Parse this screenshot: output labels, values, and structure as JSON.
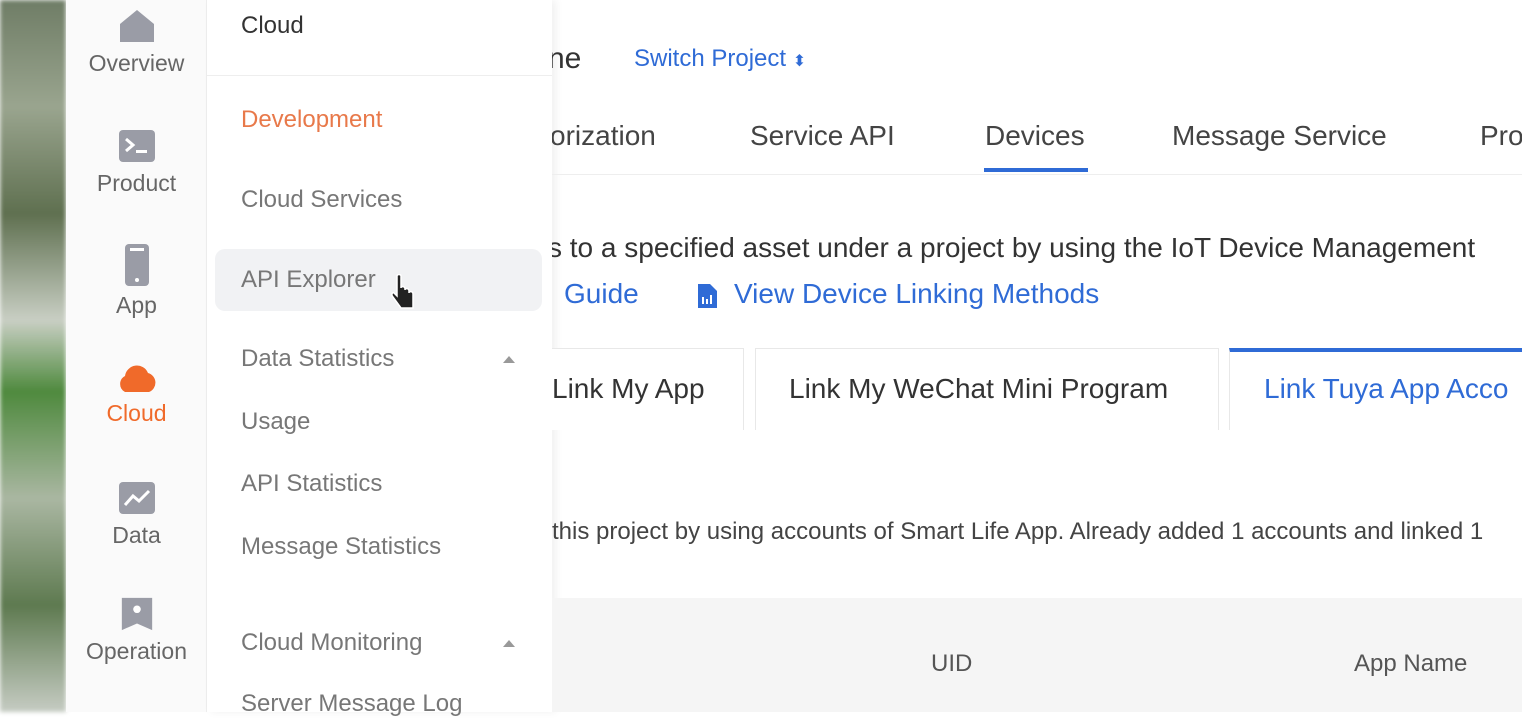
{
  "rail": {
    "items": [
      {
        "label": "Overview",
        "icon": "home-icon"
      },
      {
        "label": "Product",
        "icon": "terminal-icon"
      },
      {
        "label": "App",
        "icon": "phone-icon"
      },
      {
        "label": "Cloud",
        "icon": "cloud-icon",
        "active": true
      },
      {
        "label": "Data",
        "icon": "chart-icon"
      },
      {
        "label": "Operation",
        "icon": "bookmark-star-icon"
      }
    ]
  },
  "submenu": {
    "title": "Cloud",
    "items": [
      "Development",
      "Cloud Services",
      "API Explorer",
      "Data Statistics",
      "Usage",
      "API Statistics",
      "Message Statistics",
      "Cloud Monitoring",
      "Server Message Log"
    ]
  },
  "header": {
    "title_fragment": "ne",
    "switch_project": "Switch Project"
  },
  "tabs": [
    "orization",
    "Service API",
    "Devices",
    "Message Service",
    "Pro"
  ],
  "active_tab": "Devices",
  "description": "s to a specified asset under a project by using the IoT Device Management",
  "links": {
    "guide": "Guide",
    "view_methods": "View Device Linking Methods"
  },
  "subtabs": [
    "Link My App",
    "Link My WeChat Mini Program",
    "Link Tuya App Acco"
  ],
  "info": "this project by using accounts of Smart Life App. Already added 1 accounts and linked 1",
  "table": {
    "columns": [
      "UID",
      "App Name"
    ]
  },
  "colors": {
    "accent": "#2f6bd6",
    "cloud_orange": "#f06a2a"
  }
}
